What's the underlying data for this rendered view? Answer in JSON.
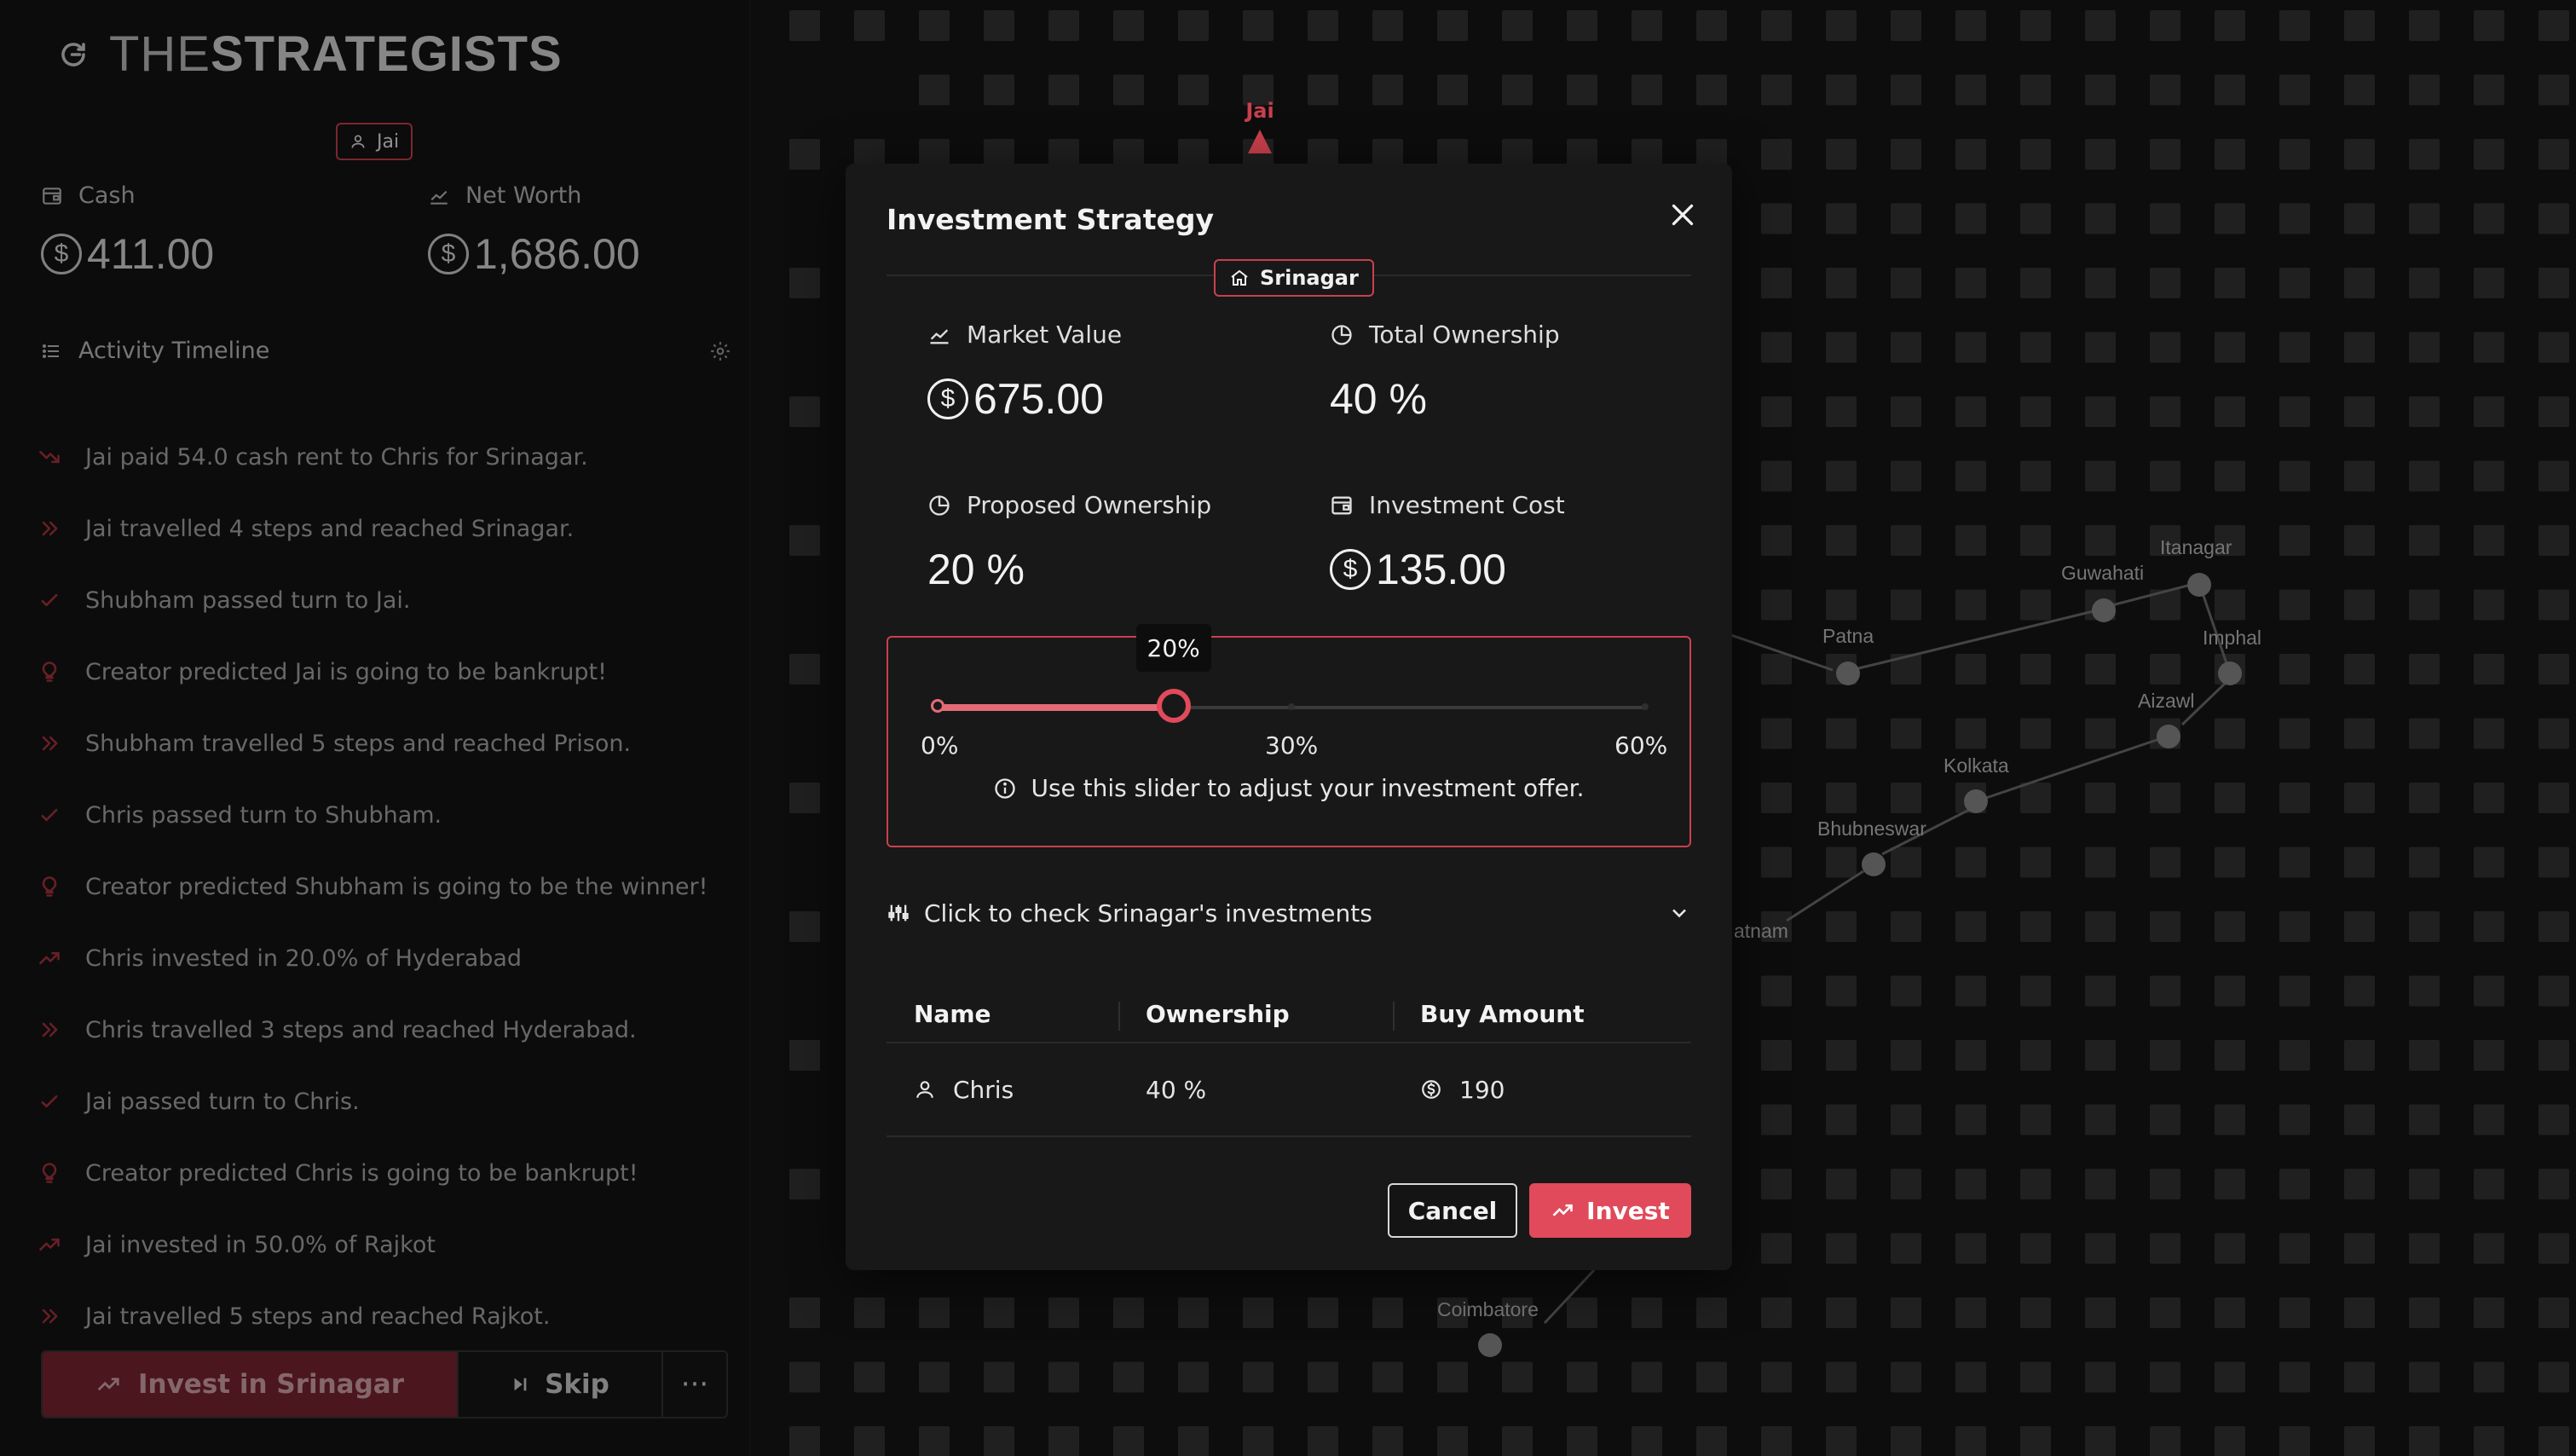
{
  "app": {
    "logo_thin": "THE",
    "logo_bold": "STRATEGISTS"
  },
  "player": {
    "name": "Jai"
  },
  "stats": {
    "cash_label": "Cash",
    "cash_value": "411.00",
    "networth_label": "Net Worth",
    "networth_value": "1,686.00"
  },
  "timeline": {
    "title": "Activity Timeline",
    "items": [
      {
        "icon": "trending-down-icon",
        "text": "Jai paid 54.0 cash rent to Chris for Srinagar."
      },
      {
        "icon": "chevrons-right-icon",
        "text": "Jai travelled 4 steps and reached Srinagar."
      },
      {
        "icon": "check-icon",
        "text": "Shubham passed turn to Jai."
      },
      {
        "icon": "bulb-icon",
        "text": "Creator predicted Jai is going to be bankrupt!"
      },
      {
        "icon": "chevrons-right-icon",
        "text": "Shubham travelled 5 steps and reached Prison."
      },
      {
        "icon": "check-icon",
        "text": "Chris passed turn to Shubham."
      },
      {
        "icon": "bulb-icon",
        "text": "Creator predicted Shubham is going to be the winner!"
      },
      {
        "icon": "trending-up-icon",
        "text": "Chris invested in 20.0% of Hyderabad"
      },
      {
        "icon": "chevrons-right-icon",
        "text": "Chris travelled 3 steps and reached Hyderabad."
      },
      {
        "icon": "check-icon",
        "text": "Jai passed turn to Chris."
      },
      {
        "icon": "bulb-icon",
        "text": "Creator predicted Chris is going to be bankrupt!"
      },
      {
        "icon": "trending-up-icon",
        "text": "Jai invested in 50.0% of Rajkot"
      },
      {
        "icon": "chevrons-right-icon",
        "text": "Jai travelled 5 steps and reached Rajkot."
      }
    ]
  },
  "actions": {
    "invest_label": "Invest in Srinagar",
    "skip_label": "Skip",
    "more_label": "···"
  },
  "map": {
    "marker_name": "Jai",
    "cities": [
      "Itanagar",
      "Guwahati",
      "Patna",
      "Imphal",
      "Aizawl",
      "Kolkata",
      "Bhubneswar",
      "atnam",
      "Coimbatore"
    ]
  },
  "modal": {
    "title": "Investment Strategy",
    "city": "Srinagar",
    "market_value_label": "Market Value",
    "market_value": "675.00",
    "total_ownership_label": "Total Ownership",
    "total_ownership": "40 %",
    "proposed_ownership_label": "Proposed Ownership",
    "proposed_ownership": "20 %",
    "investment_cost_label": "Investment Cost",
    "investment_cost": "135.00",
    "slider": {
      "value": 20,
      "min": 0,
      "max": 60,
      "value_label": "20%",
      "min_label": "0%",
      "mid_label": "30%",
      "max_label": "60%",
      "hint": "Use this slider to adjust your investment offer."
    },
    "investments_toggle": "Click to check Srinagar's investments",
    "table": {
      "headers": [
        "Name",
        "Ownership",
        "Buy Amount"
      ],
      "rows": [
        {
          "name": "Chris",
          "ownership": "40  %",
          "buy_amount": "190"
        }
      ]
    },
    "cancel_label": "Cancel",
    "invest_label": "Invest"
  },
  "colors": {
    "accent": "#e04a5a",
    "accent_border": "#c9404d",
    "background": "#121212"
  }
}
